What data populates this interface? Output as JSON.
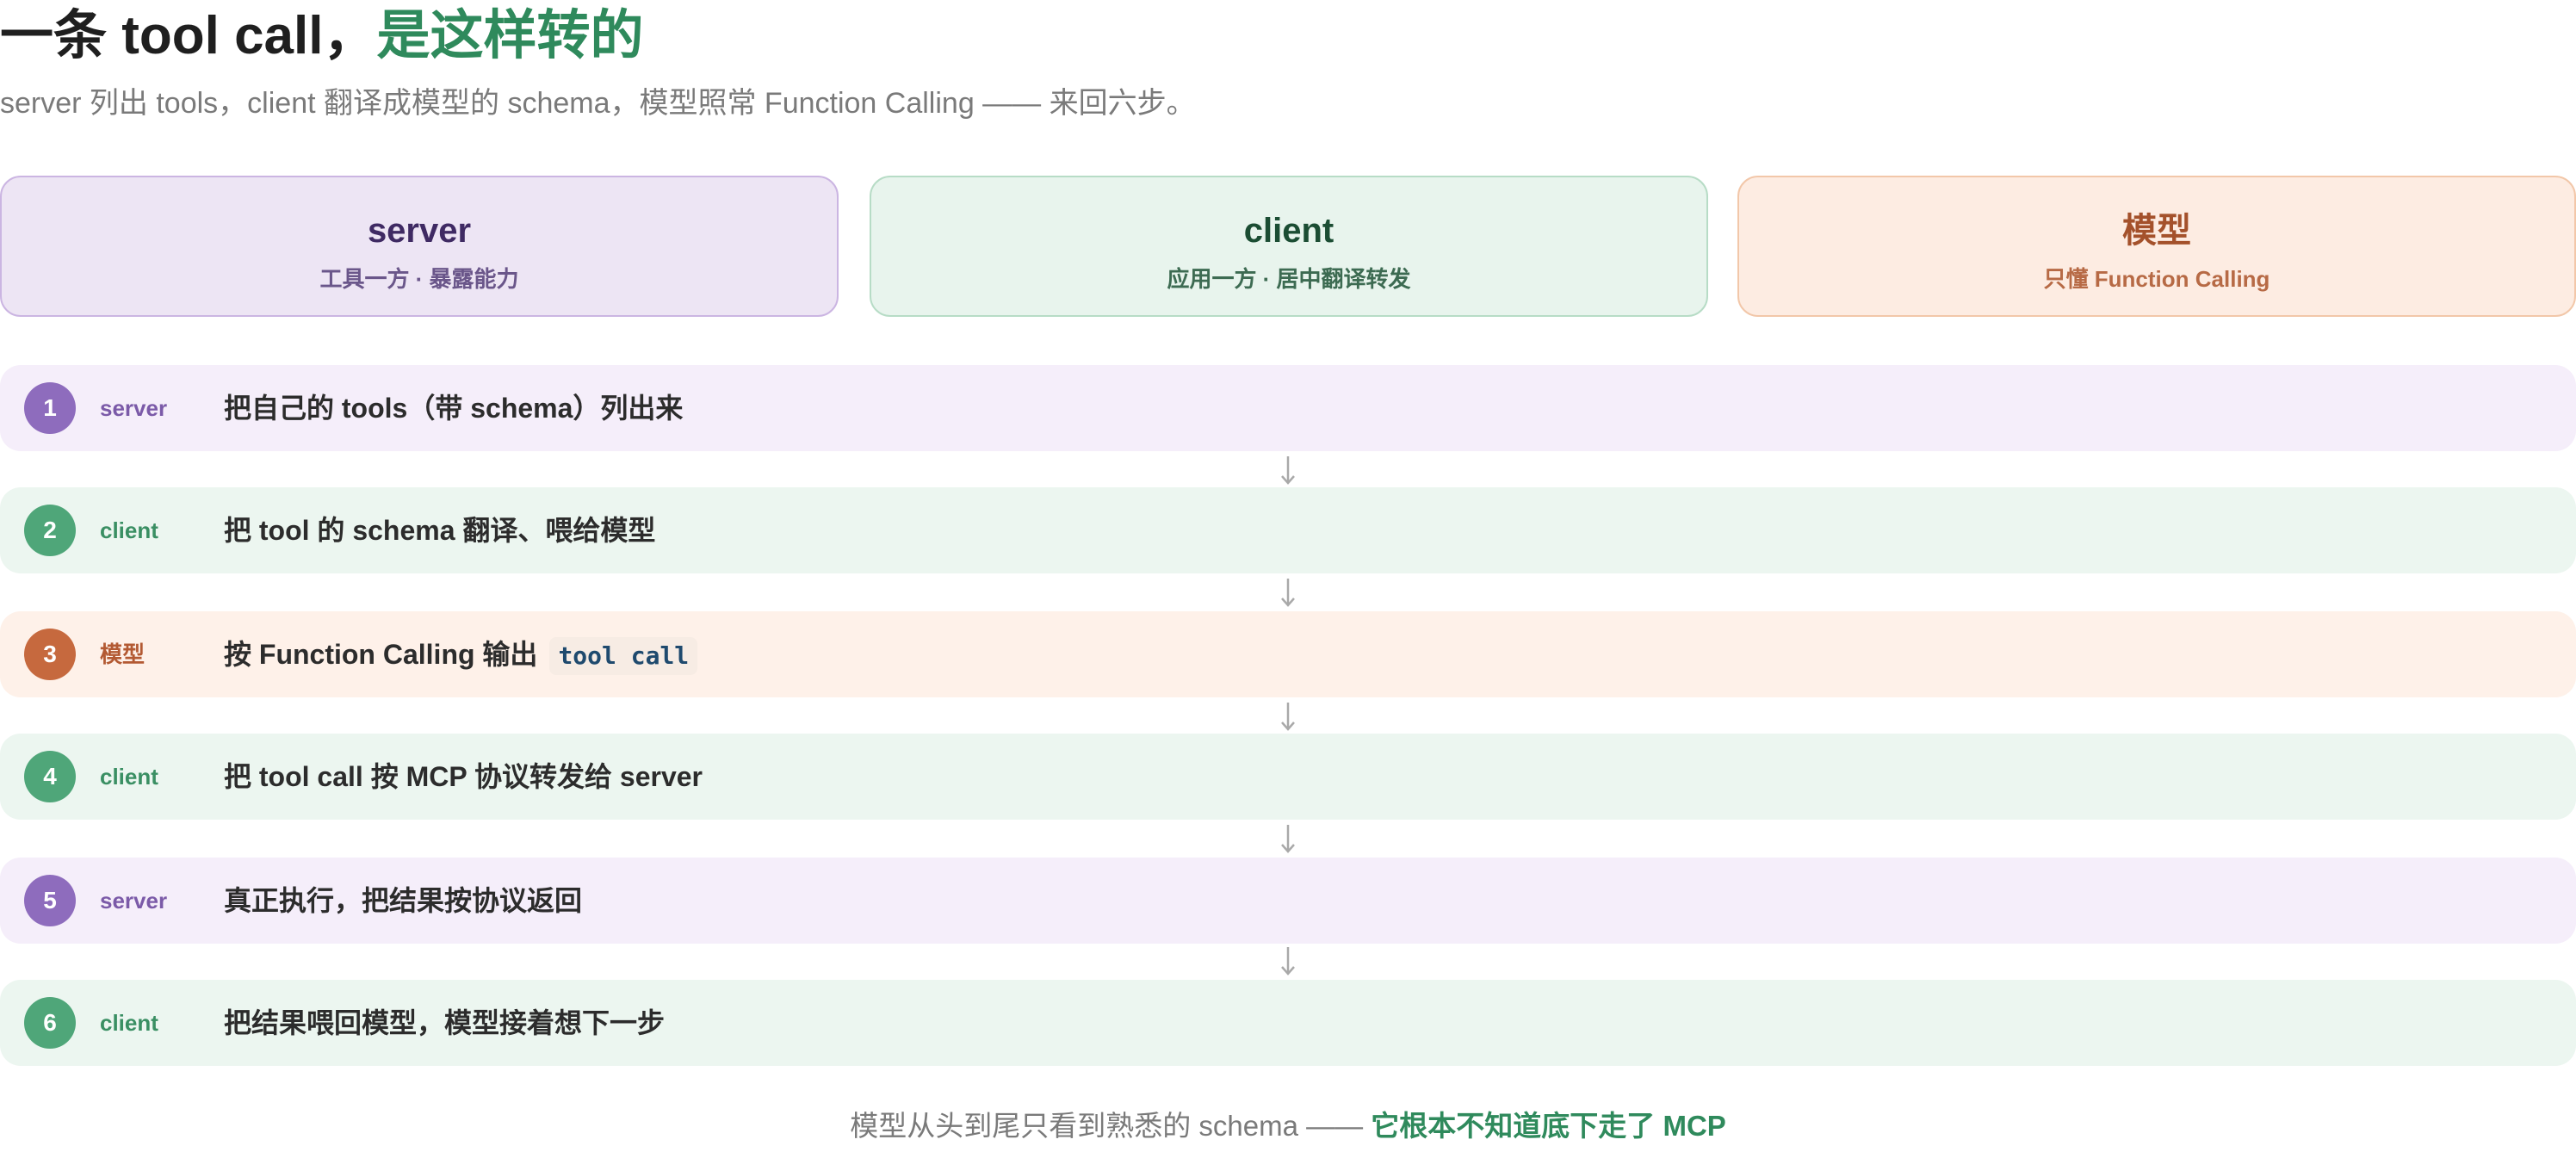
{
  "title": {
    "prefix": "一条 tool call，",
    "accent": "是这样转的"
  },
  "subtitle": "server 列出 tools，client 翻译成模型的 schema，模型照常 Function Calling —— 来回六步。",
  "actors": [
    {
      "name": "server",
      "desc": "工具一方 · 暴露能力"
    },
    {
      "name": "client",
      "desc": "应用一方 · 居中翻译转发"
    },
    {
      "name": "模型",
      "desc": "只懂 Function Calling"
    }
  ],
  "steps": [
    {
      "num": "1",
      "who": "server",
      "text": "把自己的 tools（带 schema）列出来",
      "code": ""
    },
    {
      "num": "2",
      "who": "client",
      "text": "把 tool 的 schema 翻译、喂给模型",
      "code": ""
    },
    {
      "num": "3",
      "who": "模型",
      "text": "按 Function Calling 输出",
      "code": "tool call"
    },
    {
      "num": "4",
      "who": "client",
      "text": "把 tool call 按 MCP 协议转发给 server",
      "code": ""
    },
    {
      "num": "5",
      "who": "server",
      "text": "真正执行，把结果按协议返回",
      "code": ""
    },
    {
      "num": "6",
      "who": "client",
      "text": "把结果喂回模型，模型接着想下一步",
      "code": ""
    }
  ],
  "footer": {
    "plain": "模型从头到尾只看到熟悉的 schema —— ",
    "emph": "它根本不知道底下走了 MCP"
  },
  "colors": {
    "server_accent": "#8e6cbd",
    "client_accent": "#4fa679",
    "model_accent": "#c6693e",
    "title_accent": "#2f8a5c"
  }
}
